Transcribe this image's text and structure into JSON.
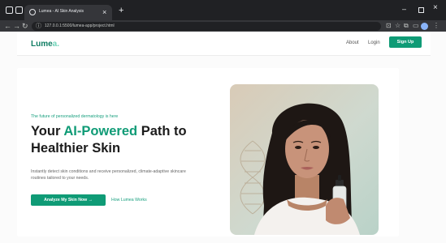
{
  "browser": {
    "tab_title": "Lumea - AI Skin Analysis",
    "new_tab": "+",
    "tab_close": "×",
    "url": "127.0.0.1:5500/lumea-app/project.html",
    "minimize": "–",
    "close": "×"
  },
  "header": {
    "logo_main": "Lume",
    "logo_accent": "a.",
    "nav": [
      {
        "label": "About"
      },
      {
        "label": "Login"
      }
    ],
    "signup_label": "Sign Up"
  },
  "hero": {
    "tagline": "The future of personalized dermatology is here",
    "headline_prefix": "Your ",
    "headline_highlight": "AI-Powered",
    "headline_middle": " Path to",
    "headline_line2": "Healthier Skin",
    "description": "Instantly detect skin conditions and receive personalized, climate-adaptive skincare routines tailored to your needs.",
    "cta_label": "Analyze My Skin Now →",
    "secondary_label": "How Lumea Works"
  },
  "colors": {
    "brand": "#0f9b76",
    "brand_dark": "#0f7d63",
    "accent_light": "#6ed3b8",
    "chrome_dark": "#202124"
  }
}
